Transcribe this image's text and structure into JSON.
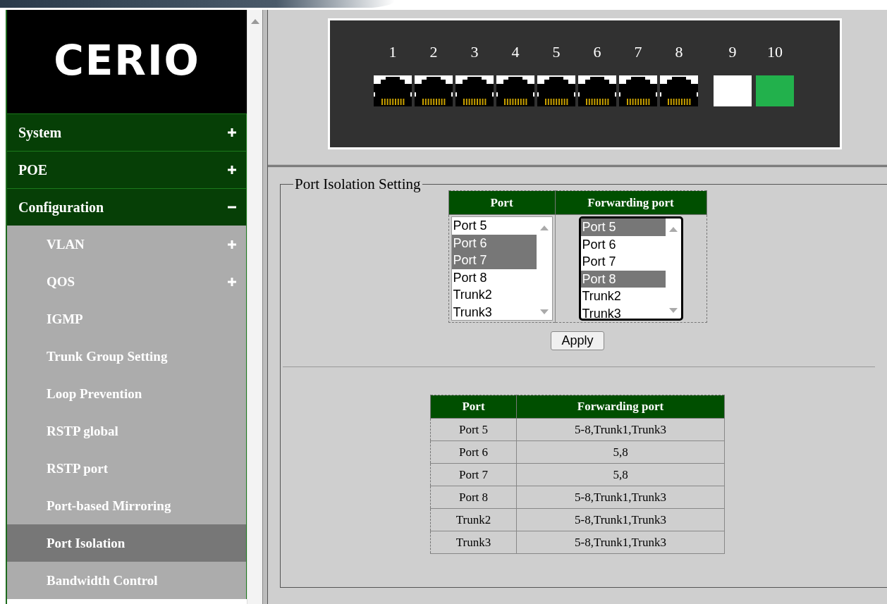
{
  "sidebar": {
    "logo": "CERIO",
    "items": [
      {
        "label": "System",
        "expanded": false
      },
      {
        "label": "POE",
        "expanded": false
      },
      {
        "label": "Configuration",
        "expanded": true,
        "children": [
          {
            "label": "VLAN",
            "expanded": false,
            "selected": false
          },
          {
            "label": "QOS",
            "expanded": false,
            "selected": false
          },
          {
            "label": "IGMP",
            "selected": false
          },
          {
            "label": "Trunk Group Setting",
            "selected": false
          },
          {
            "label": "Loop Prevention",
            "selected": false
          },
          {
            "label": "RSTP global",
            "selected": false
          },
          {
            "label": "RSTP port",
            "selected": false
          },
          {
            "label": "Port-based Mirroring",
            "selected": false
          },
          {
            "label": "Port Isolation",
            "selected": true
          },
          {
            "label": "Bandwidth Control",
            "selected": false
          }
        ]
      }
    ]
  },
  "switch_panel": {
    "ports": [
      {
        "label": "1",
        "kind": "rj45"
      },
      {
        "label": "2",
        "kind": "rj45"
      },
      {
        "label": "3",
        "kind": "rj45"
      },
      {
        "label": "4",
        "kind": "rj45"
      },
      {
        "label": "5",
        "kind": "rj45"
      },
      {
        "label": "6",
        "kind": "rj45"
      },
      {
        "label": "7",
        "kind": "rj45"
      },
      {
        "label": "8",
        "kind": "rj45"
      },
      {
        "label": "9",
        "kind": "sfp",
        "color": "#ffffff"
      },
      {
        "label": "10",
        "kind": "sfp",
        "color": "#22b14c"
      }
    ]
  },
  "port_isolation": {
    "title": "Port Isolation Setting",
    "selector": {
      "columns": [
        "Port",
        "Forwarding port"
      ],
      "lists": [
        {
          "focused": false,
          "options": [
            {
              "label": "Port 5",
              "selected": false
            },
            {
              "label": "Port 6",
              "selected": true
            },
            {
              "label": "Port 7",
              "selected": true
            },
            {
              "label": "Port 8",
              "selected": false
            },
            {
              "label": "Trunk2",
              "selected": false
            },
            {
              "label": "Trunk3",
              "selected": false
            }
          ]
        },
        {
          "focused": true,
          "options": [
            {
              "label": "Port 5",
              "selected": true
            },
            {
              "label": "Port 6",
              "selected": false
            },
            {
              "label": "Port 7",
              "selected": false
            },
            {
              "label": "Port 8",
              "selected": true
            },
            {
              "label": "Trunk2",
              "selected": false
            },
            {
              "label": "Trunk3",
              "selected": false
            }
          ]
        }
      ]
    },
    "apply_button": "Apply",
    "table": {
      "columns": [
        "Port",
        "Forwarding port"
      ],
      "rows": [
        [
          "Port 5",
          "5-8,Trunk1,Trunk3"
        ],
        [
          "Port 6",
          "5,8"
        ],
        [
          "Port 7",
          "5,8"
        ],
        [
          "Port 8",
          "5-8,Trunk1,Trunk3"
        ],
        [
          "Trunk2",
          "5-8,Trunk1,Trunk3"
        ],
        [
          "Trunk3",
          "5-8,Trunk1,Trunk3"
        ]
      ]
    }
  }
}
